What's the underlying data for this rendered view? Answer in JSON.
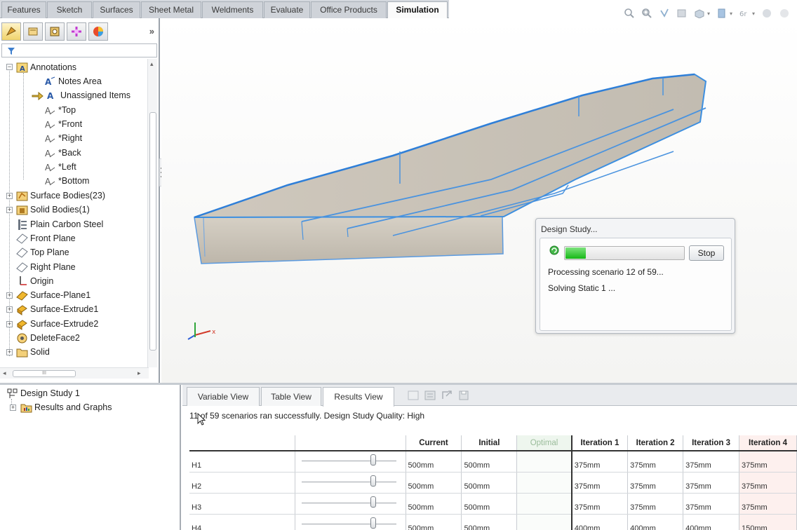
{
  "command_tabs": [
    {
      "label": "Features"
    },
    {
      "label": "Sketch"
    },
    {
      "label": "Surfaces"
    },
    {
      "label": "Sheet Metal"
    },
    {
      "label": "Weldments"
    },
    {
      "label": "Evaluate"
    },
    {
      "label": "Office Products"
    },
    {
      "label": "Simulation",
      "active": true
    }
  ],
  "heads_up_icons": [
    "zoom-to-fit-icon",
    "zoom-to-area-icon",
    "previous-view-icon",
    "section-view-icon",
    "view-orientation-icon",
    "display-style-icon",
    "hide-show-items-icon",
    "edit-appearance-icon",
    "apply-scene-icon"
  ],
  "feature_tree": {
    "nodes": [
      {
        "label": "Annotations",
        "icon": "annotations-icon",
        "level": 0,
        "expanded": true
      },
      {
        "label": "Notes Area",
        "icon": "notes-area-icon",
        "level": 2
      },
      {
        "label": "Unassigned Items",
        "icon": "unassigned-items-icon",
        "level": 2
      },
      {
        "label": "*Top",
        "icon": "annotation-view-icon",
        "level": 2
      },
      {
        "label": "*Front",
        "icon": "annotation-view-icon",
        "level": 2
      },
      {
        "label": "*Right",
        "icon": "annotation-view-icon",
        "level": 2
      },
      {
        "label": "*Back",
        "icon": "annotation-view-icon",
        "level": 2
      },
      {
        "label": "*Left",
        "icon": "annotation-view-icon",
        "level": 2
      },
      {
        "label": "*Bottom",
        "icon": "annotation-view-icon",
        "level": 2
      },
      {
        "label": "Surface Bodies(23)",
        "icon": "surface-bodies-icon",
        "level": 0,
        "expandable": true
      },
      {
        "label": "Solid Bodies(1)",
        "icon": "solid-bodies-icon",
        "level": 0,
        "expandable": true
      },
      {
        "label": "Plain Carbon Steel",
        "icon": "material-icon",
        "level": 0
      },
      {
        "label": "Front Plane",
        "icon": "plane-icon",
        "level": 0
      },
      {
        "label": "Top Plane",
        "icon": "plane-icon",
        "level": 0
      },
      {
        "label": "Right Plane",
        "icon": "plane-icon",
        "level": 0
      },
      {
        "label": "Origin",
        "icon": "origin-icon",
        "level": 0
      },
      {
        "label": "Surface-Plane1",
        "icon": "surface-plane-icon",
        "level": 0,
        "expandable": true
      },
      {
        "label": "Surface-Extrude1",
        "icon": "surface-extrude-icon",
        "level": 0,
        "expandable": true
      },
      {
        "label": "Surface-Extrude2",
        "icon": "surface-extrude-icon",
        "level": 0,
        "expandable": true
      },
      {
        "label": "DeleteFace2",
        "icon": "delete-face-icon",
        "level": 0
      },
      {
        "label": "Solid",
        "icon": "folder-icon",
        "level": 0,
        "expandable": true
      }
    ],
    "hscroll_label": "III"
  },
  "dialog": {
    "title": "Design Study...",
    "progress": 0.17,
    "stop_label": "Stop",
    "line1": "Processing scenario 12 of 59...",
    "line2": "Solving Static 1 ..."
  },
  "study_tree": {
    "root": "Design Study 1",
    "child": "Results and Graphs"
  },
  "results": {
    "tabs": [
      "Variable View",
      "Table View",
      "Results View"
    ],
    "active_tab": 2,
    "status": "11 of 59 scenarios ran successfully. Design Study Quality: High",
    "columns": [
      "",
      "",
      "Current",
      "Initial",
      "Optimal",
      "Iteration 1",
      "Iteration 2",
      "Iteration 3",
      "Iteration 4"
    ],
    "rows": [
      {
        "name": "H1",
        "slider": 0.78,
        "current": "500mm",
        "initial": "500mm",
        "optimal": "",
        "it1": "375mm",
        "it2": "375mm",
        "it3": "375mm",
        "it4": "375mm"
      },
      {
        "name": "H2",
        "slider": 0.78,
        "current": "500mm",
        "initial": "500mm",
        "optimal": "",
        "it1": "375mm",
        "it2": "375mm",
        "it3": "375mm",
        "it4": "375mm"
      },
      {
        "name": "H3",
        "slider": 0.78,
        "current": "500mm",
        "initial": "500mm",
        "optimal": "",
        "it1": "375mm",
        "it2": "375mm",
        "it3": "375mm",
        "it4": "375mm"
      },
      {
        "name": "H4",
        "slider": 0.78,
        "current": "500mm",
        "initial": "500mm",
        "optimal": "",
        "it1": "400mm",
        "it2": "400mm",
        "it3": "400mm",
        "it4": "150mm"
      }
    ]
  },
  "colors": {
    "accent_blue": "#2f6fd6",
    "progress_green": "#16b816",
    "model_edge": "#3d8fe0",
    "model_face": "#c9c3b8"
  }
}
